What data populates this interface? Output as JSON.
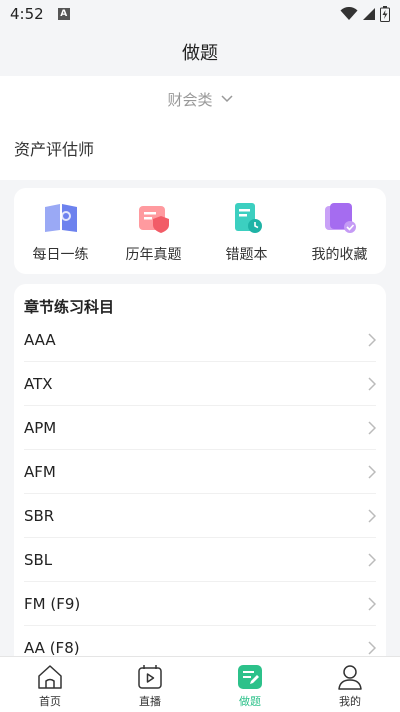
{
  "statusbar": {
    "time": "4:52",
    "notification_icon": "A"
  },
  "header": {
    "title": "做题"
  },
  "category": {
    "label": "财会类"
  },
  "subject": {
    "label": "资产评估师"
  },
  "quick": [
    {
      "label": "每日一练",
      "icon": "daily-practice-icon"
    },
    {
      "label": "历年真题",
      "icon": "past-papers-icon"
    },
    {
      "label": "错题本",
      "icon": "wrong-questions-icon"
    },
    {
      "label": "我的收藏",
      "icon": "favorites-icon"
    }
  ],
  "chapter": {
    "title": "章节练习科目",
    "items": [
      "AAA",
      "ATX",
      "APM",
      "AFM",
      "SBR",
      "SBL",
      "FM (F9)",
      "AA (F8)"
    ]
  },
  "tabs": [
    {
      "label": "首页",
      "icon": "home-icon"
    },
    {
      "label": "直播",
      "icon": "live-icon"
    },
    {
      "label": "做题",
      "icon": "practice-icon",
      "active": true
    },
    {
      "label": "我的",
      "icon": "profile-icon"
    }
  ],
  "colors": {
    "accent": "#2cc18a",
    "background": "#f4f5f7"
  }
}
